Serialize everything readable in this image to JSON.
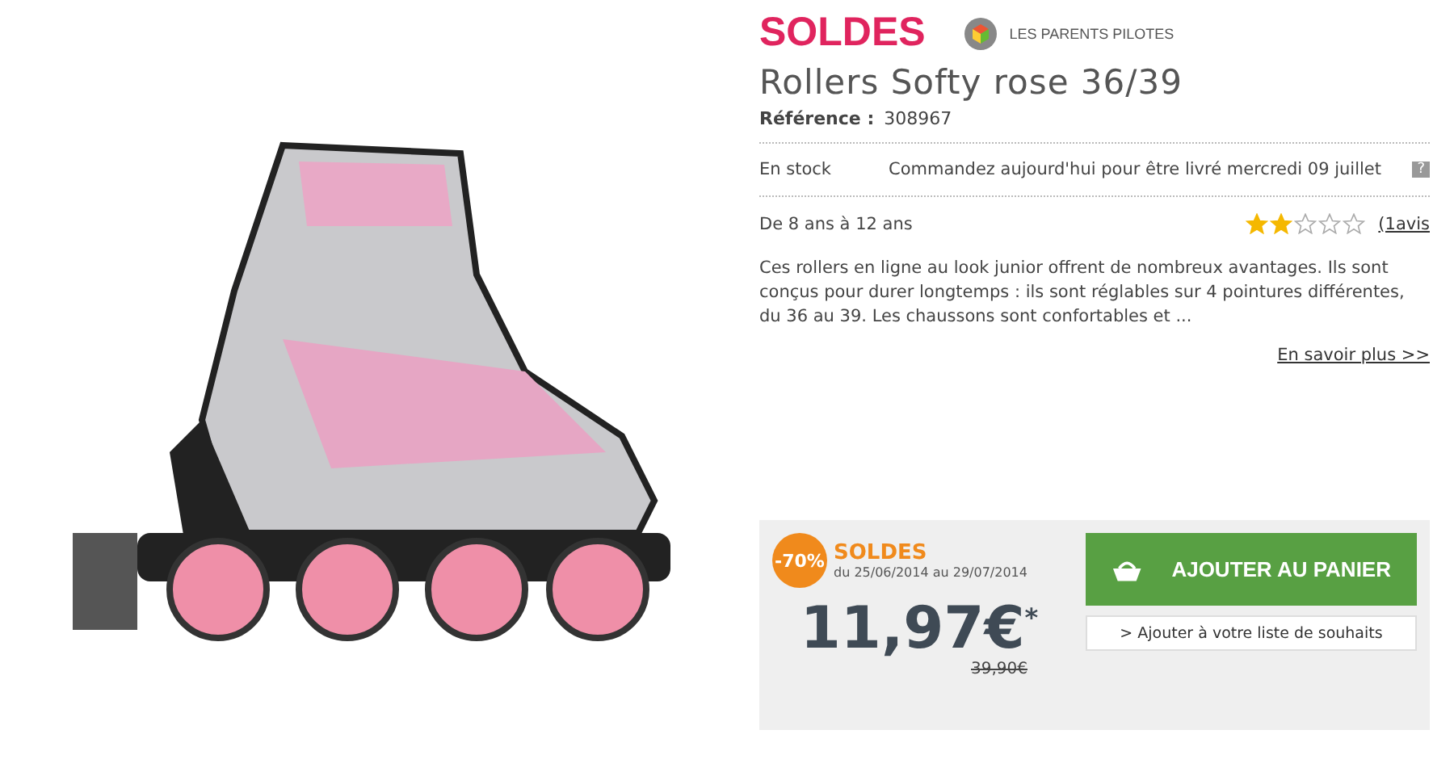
{
  "brand_logo": "SOLDES",
  "partner": "LES PARENTS PILOTES",
  "product": {
    "title": "Rollers Softy rose 36/39",
    "reference_label": "Référence :",
    "reference": "308967"
  },
  "availability": {
    "status": "En stock",
    "delivery": "Commandez aujourd'hui pour être livré mercredi 09 juillet",
    "help": "?"
  },
  "age": "De 8 ans à 12 ans",
  "rating": {
    "stars": 2,
    "reviews": "(1avis"
  },
  "description": "Ces rollers en ligne au look junior offrent de nombreux avantages. Ils sont conçus pour durer longtemps : ils sont réglables sur 4 pointures différentes, du 36 au 39. Les chaussons sont confortables et ...",
  "more_link": "En savoir plus >>",
  "offer": {
    "discount": "-70%",
    "label": "SOLDES",
    "dates": "du 25/06/2014 au 29/07/2014",
    "price": "11,97€",
    "price_mark": "*",
    "old_price": "39,90€"
  },
  "buttons": {
    "add_to_cart": "AJOUTER AU PANIER",
    "wishlist": "> Ajouter à votre liste de souhaits"
  }
}
